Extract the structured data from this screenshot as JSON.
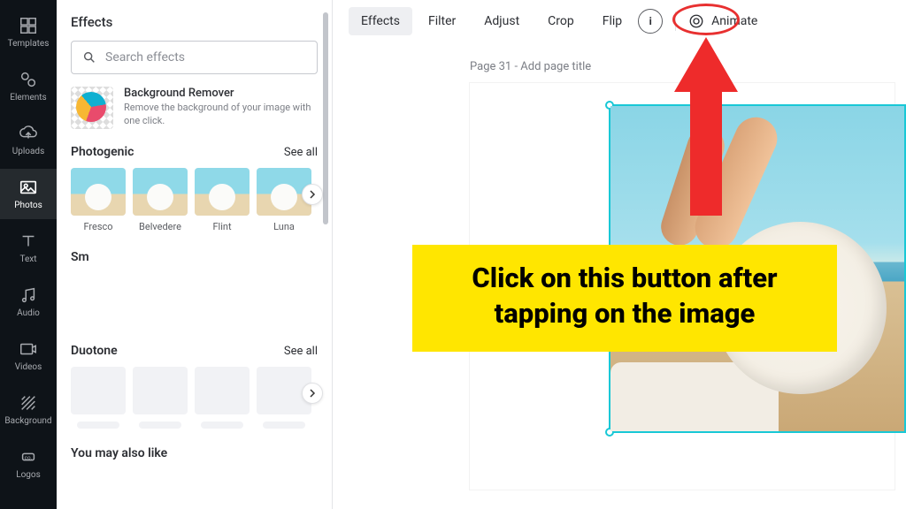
{
  "sidebar": {
    "items": [
      {
        "label": "Templates",
        "icon": "templates"
      },
      {
        "label": "Elements",
        "icon": "elements"
      },
      {
        "label": "Uploads",
        "icon": "uploads"
      },
      {
        "label": "Photos",
        "icon": "photos"
      },
      {
        "label": "Text",
        "icon": "text"
      },
      {
        "label": "Audio",
        "icon": "audio"
      },
      {
        "label": "Videos",
        "icon": "videos"
      },
      {
        "label": "Background",
        "icon": "background"
      },
      {
        "label": "Logos",
        "icon": "logos"
      }
    ]
  },
  "panel": {
    "title": "Effects",
    "search_placeholder": "Search effects",
    "bg_remover": {
      "title": "Background Remover",
      "desc": "Remove the background of your image with one click."
    },
    "sections": {
      "photogenic": {
        "title": "Photogenic",
        "see_all": "See all",
        "items": [
          "Fresco",
          "Belvedere",
          "Flint",
          "Luna"
        ]
      },
      "smart": {
        "title": "Sm",
        "see_all": ""
      },
      "duotone": {
        "title": "Duotone",
        "see_all": "See all"
      },
      "youmay": {
        "title": "You may also like"
      }
    }
  },
  "toolbar": {
    "effects": "Effects",
    "filter": "Filter",
    "adjust": "Adjust",
    "crop": "Crop",
    "flip": "Flip",
    "animate": "Animate"
  },
  "canvas": {
    "page_label": "Page 31 - Add page title"
  },
  "annotation": {
    "callout": "Click on this button after tapping on the image"
  }
}
